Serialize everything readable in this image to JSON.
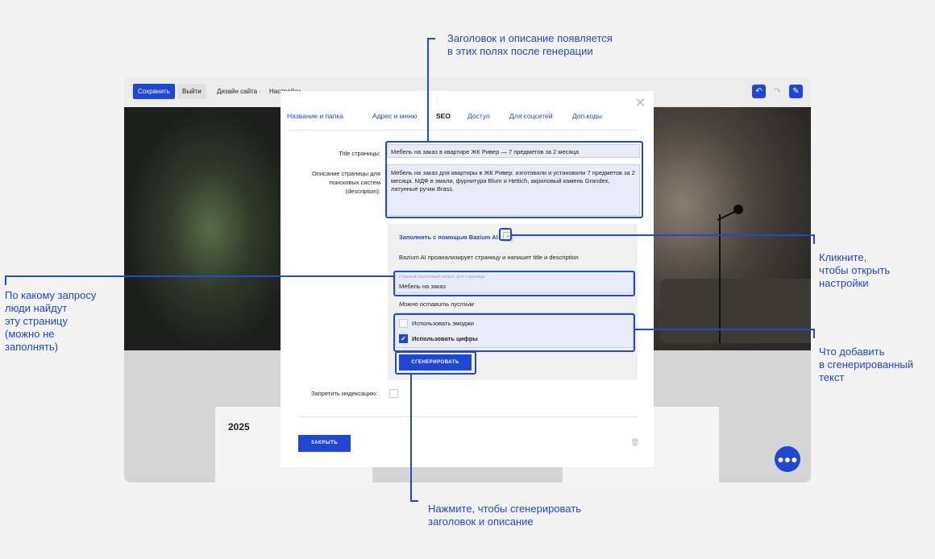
{
  "topbar": {
    "save": "Сохранить",
    "exit": "Выйти",
    "design": "Дизайн сайта ·",
    "settings": "Настройки ·"
  },
  "background": {
    "card_year": "2025"
  },
  "modal": {
    "tabs": [
      "Название и папка",
      "Адрес и меню",
      "SEO",
      "Доступ",
      "Для соцсетей",
      "Доп.коды"
    ],
    "active_tab": "SEO",
    "title_label": "Title страницы:",
    "title_value": "Мебель на заказ в квартире ЖК Ривер — 7 предметов за 2 месяца",
    "desc_label": "Описание страницы для поисковых систем (description):",
    "desc_value": "Мебель на заказ для квартиры в ЖК Ривер: изготовили и установили 7 предметов за 2 месяца. МДФ в эмали, фурнитура Blum и Hettich, акриловый камень Grandex, латунные ручки Brass.",
    "ai": {
      "link": "Заполнить с помощью Bazium AI",
      "description": "Bazium AI проанализирует страницу и напишет title и description",
      "query_placeholder": "Главный поисковый запрос для страницы",
      "query_value": "Мебель на заказ",
      "hint": "Можно оставить пустым",
      "emoji_label": "Использовать эмоджи",
      "emoji_checked": false,
      "digits_label": "Использовать цифры",
      "digits_checked": true,
      "generate_button": "СГЕНЕРИРОВАТЬ"
    },
    "noindex_label": "Запретить индексацию:",
    "close_button": "ЗАКРЫТЬ"
  },
  "callouts": {
    "top": "Заголовок и описание появляется\nв этих полях после генерации",
    "right_settings": "Кликните,\nчтобы открыть\nнастройки",
    "left_query": "По какому запросу\nлюди найдут\nэту страницу\n(можно не\nзаполнять)",
    "right_options": "Что добавить\nв сгенерированный\nтекст",
    "bottom": "Нажмите, чтобы сгенерировать\nзаголовок и описание"
  },
  "colors": {
    "accent": "#1f47d6",
    "field_bg": "#e8ebf8"
  }
}
